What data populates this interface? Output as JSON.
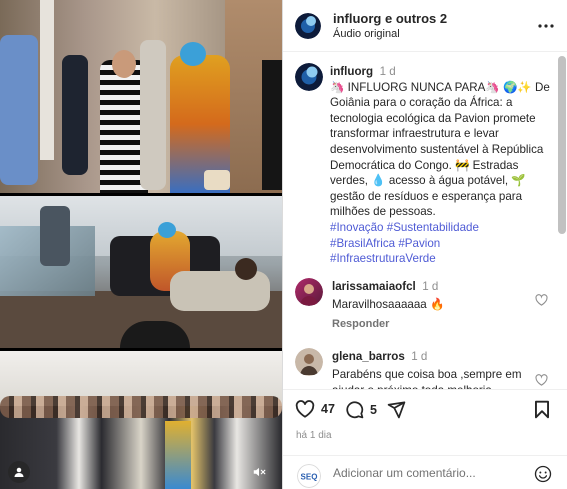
{
  "header": {
    "title": "influorg e outros 2",
    "subtitle": "Áudio original"
  },
  "caption": {
    "username": "influorg",
    "time": "1 d",
    "text": "🦄 INFLUORG NUNCA PARA🦄 🌍✨ De Goiânia para o coração da África: a tecnologia ecológica da Pavion promete transformar infraestrutura e levar desenvolvimento sustentável à República Democrática do Congo. 🚧 Estradas verdes, 💧 acesso à água potável, 🌱 gestão de resíduos e esperança para milhões de pessoas.",
    "hashtags": [
      "#Inovação",
      "#Sustentabilidade",
      "#BrasilAfrica",
      "#Pavion",
      "#InfraestruturaVerde"
    ]
  },
  "comments": [
    {
      "username": "larissamaiaofcl",
      "time": "1 d",
      "text": "Maravilhosaaaaaa 🔥",
      "reply_label": "Responder"
    },
    {
      "username": "glena_barros",
      "time": "1 d",
      "text": "Parabéns que coisa boa ,sempre em ajudar o próximo toda melhoria"
    }
  ],
  "actions": {
    "likes": "47",
    "comments": "5",
    "time_ago": "há 1 dia"
  },
  "add_comment": {
    "placeholder": "Adicionar um comentário..."
  },
  "icons": {
    "more": "more-horizontal-icon",
    "like": "heart-icon",
    "comment": "comment-icon",
    "share": "send-icon",
    "save": "bookmark-icon",
    "emoji": "emoji-icon",
    "tag": "user-tag-icon",
    "mute": "speaker-muted-icon"
  },
  "colors": {
    "hashtag": "#4f5bd5",
    "secondary_text": "#8e8e8e"
  }
}
